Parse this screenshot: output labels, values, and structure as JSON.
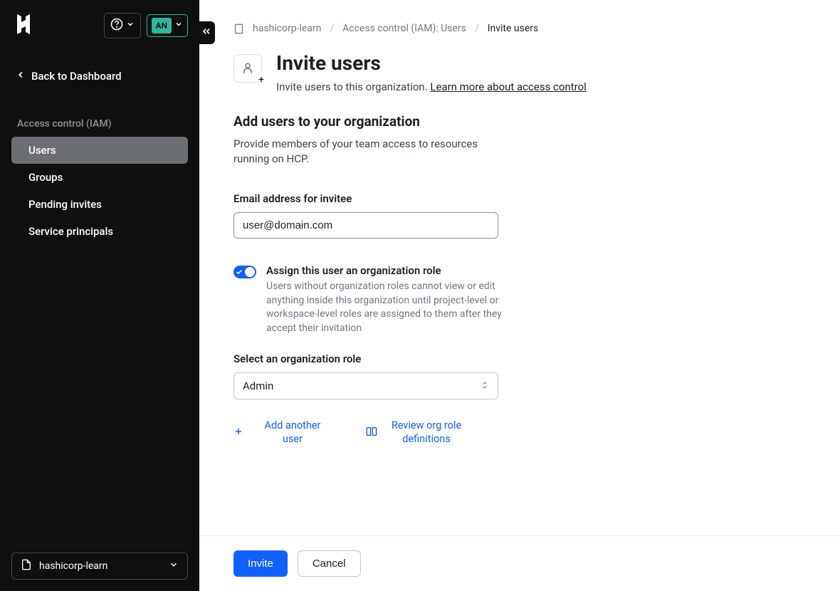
{
  "header": {
    "avatar_initials": "AN"
  },
  "sidebar": {
    "back_label": "Back to Dashboard",
    "section_header": "Access control (IAM)",
    "items": [
      {
        "label": "Users",
        "active": true
      },
      {
        "label": "Groups",
        "active": false
      },
      {
        "label": "Pending invites",
        "active": false
      },
      {
        "label": "Service principals",
        "active": false
      }
    ],
    "project_name": "hashicorp-learn"
  },
  "breadcrumb": {
    "org": "hashicorp-learn",
    "parent": "Access control (IAM): Users",
    "current": "Invite users"
  },
  "page": {
    "title": "Invite users",
    "subtitle_text": "Invite users to this organization. ",
    "subtitle_link": "Learn more about access control"
  },
  "form": {
    "section_title": "Add users to your organization",
    "section_desc": "Provide members of your team access to resources running on HCP.",
    "email_label": "Email address for invitee",
    "email_value": "user@domain.com",
    "toggle_label": "Assign this user an organization role",
    "toggle_desc": "Users without organization roles cannot view or edit anything inside this organization until project-level or workspace-level roles are assigned to them after they accept their invitation",
    "toggle_on": true,
    "role_label": "Select an organization role",
    "role_value": "Admin",
    "add_another_label": "Add another user",
    "review_roles_label": "Review org role definitions"
  },
  "footer": {
    "invite_label": "Invite",
    "cancel_label": "Cancel"
  }
}
